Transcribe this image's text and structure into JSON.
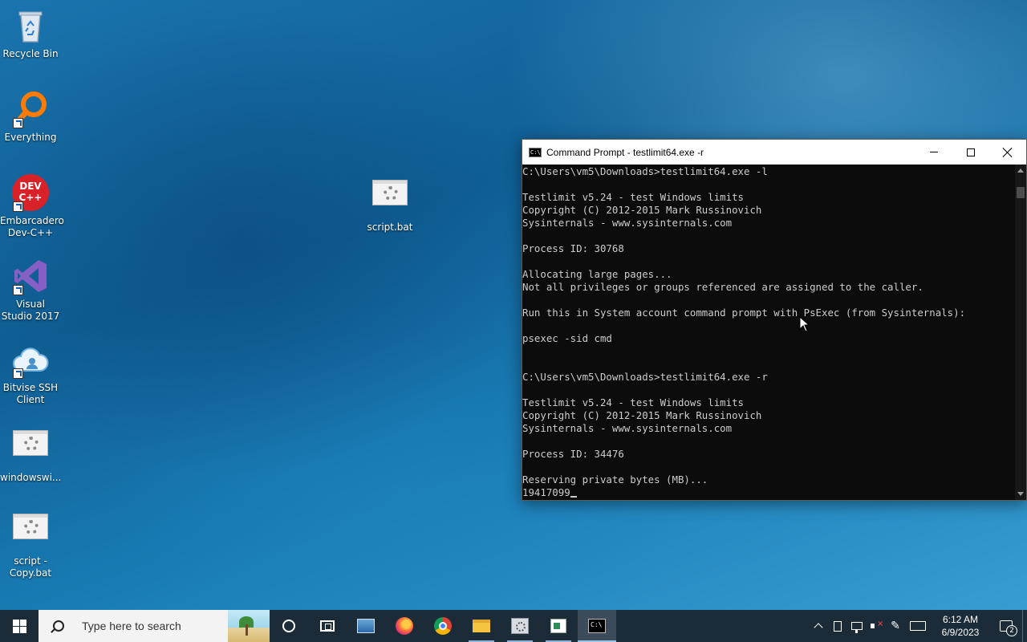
{
  "desktop": {
    "icons": [
      {
        "label": "Recycle Bin"
      },
      {
        "label": "Everything"
      },
      {
        "label": "Embarcadero Dev-C++"
      },
      {
        "label": "Visual Studio 2017"
      },
      {
        "label": "Bitvise SSH Client"
      },
      {
        "label": "windowswi..."
      },
      {
        "label": "script - Copy.bat"
      },
      {
        "label": "script.bat"
      }
    ],
    "devcpp_logo_text": "DEV C++"
  },
  "cmd_window": {
    "title": "Command Prompt - testlimit64.exe  -r",
    "lines": [
      "C:\\Users\\vm5\\Downloads>testlimit64.exe -l",
      "",
      "Testlimit v5.24 - test Windows limits",
      "Copyright (C) 2012-2015 Mark Russinovich",
      "Sysinternals - www.sysinternals.com",
      "",
      "Process ID: 30768",
      "",
      "Allocating large pages...",
      "Not all privileges or groups referenced are assigned to the caller.",
      "",
      "Run this in System account command prompt with PsExec (from Sysinternals):",
      "",
      "psexec -sid cmd",
      "",
      "",
      "C:\\Users\\vm5\\Downloads>testlimit64.exe -r",
      "",
      "Testlimit v5.24 - test Windows limits",
      "Copyright (C) 2012-2015 Mark Russinovich",
      "Sysinternals - www.sysinternals.com",
      "",
      "Process ID: 34476",
      "",
      "Reserving private bytes (MB)...",
      "19417099"
    ]
  },
  "taskbar": {
    "search_placeholder": "Type here to search",
    "clock_time": "6:12 AM",
    "clock_date": "6/9/2023",
    "notification_count": "2"
  }
}
